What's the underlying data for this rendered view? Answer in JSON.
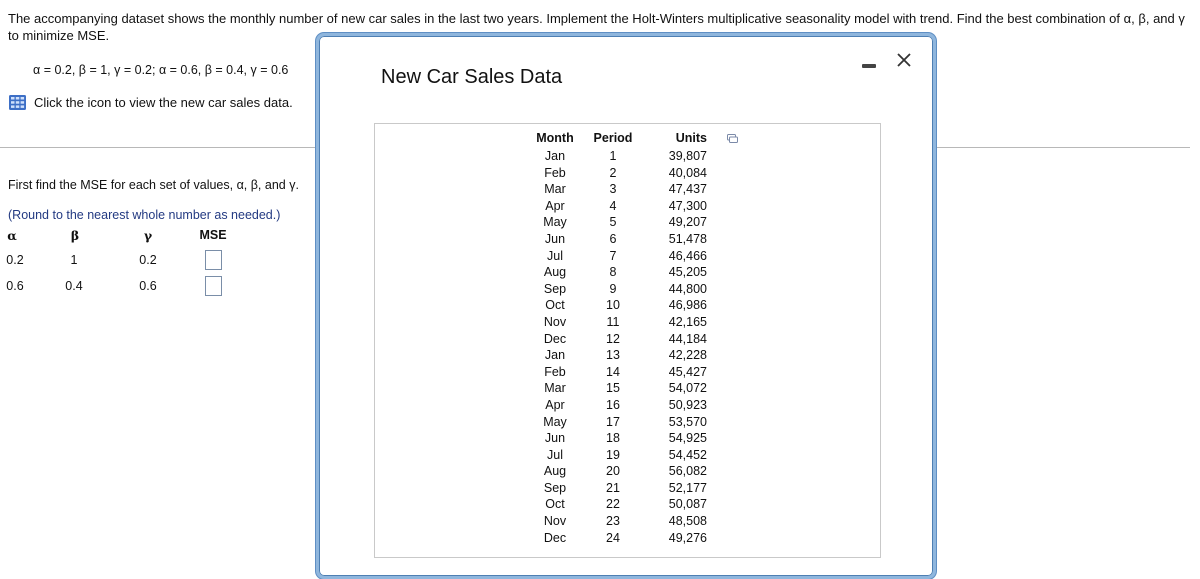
{
  "question": {
    "text": "The accompanying dataset shows the monthly number of new car sales in the last two years. Implement the Holt-Winters multiplicative seasonality model with trend. Find the best combination of α, β, and γ to minimize MSE.",
    "parameters": "α = 0.2, β = 1, γ = 0.2; α = 0.6, β = 0.4, γ = 0.6",
    "data_link": "Click the icon to view the new car sales data.",
    "data_link_icon": "table-grid-icon"
  },
  "answer_section": {
    "prompt": "First find the MSE for each set of values, α, β, and γ.",
    "note": "(Round to the nearest whole number as needed.)",
    "headers": [
      "α",
      "β",
      "γ",
      "MSE"
    ],
    "rows": [
      {
        "alpha": "0.2",
        "beta": "1",
        "gamma": "0.2",
        "mse": ""
      },
      {
        "alpha": "0.6",
        "beta": "0.4",
        "gamma": "0.6",
        "mse": ""
      }
    ]
  },
  "popup": {
    "title": "New Car Sales Data",
    "minimize_icon": "minimize-icon",
    "close_icon": "close-icon",
    "copy_icon": "copy-icon",
    "columns": [
      "Month",
      "Period",
      "Units"
    ],
    "rows": [
      {
        "month": "Jan",
        "period": "1",
        "units": "39,807"
      },
      {
        "month": "Feb",
        "period": "2",
        "units": "40,084"
      },
      {
        "month": "Mar",
        "period": "3",
        "units": "47,437"
      },
      {
        "month": "Apr",
        "period": "4",
        "units": "47,300"
      },
      {
        "month": "May",
        "period": "5",
        "units": "49,207"
      },
      {
        "month": "Jun",
        "period": "6",
        "units": "51,478"
      },
      {
        "month": "Jul",
        "period": "7",
        "units": "46,466"
      },
      {
        "month": "Aug",
        "period": "8",
        "units": "45,205"
      },
      {
        "month": "Sep",
        "period": "9",
        "units": "44,800"
      },
      {
        "month": "Oct",
        "period": "10",
        "units": "46,986"
      },
      {
        "month": "Nov",
        "period": "11",
        "units": "42,165"
      },
      {
        "month": "Dec",
        "period": "12",
        "units": "44,184"
      },
      {
        "month": "Jan",
        "period": "13",
        "units": "42,228"
      },
      {
        "month": "Feb",
        "period": "14",
        "units": "45,427"
      },
      {
        "month": "Mar",
        "period": "15",
        "units": "54,072"
      },
      {
        "month": "Apr",
        "period": "16",
        "units": "50,923"
      },
      {
        "month": "May",
        "period": "17",
        "units": "53,570"
      },
      {
        "month": "Jun",
        "period": "18",
        "units": "54,925"
      },
      {
        "month": "Jul",
        "period": "19",
        "units": "54,452"
      },
      {
        "month": "Aug",
        "period": "20",
        "units": "56,082"
      },
      {
        "month": "Sep",
        "period": "21",
        "units": "52,177"
      },
      {
        "month": "Oct",
        "period": "22",
        "units": "50,087"
      },
      {
        "month": "Nov",
        "period": "23",
        "units": "48,508"
      },
      {
        "month": "Dec",
        "period": "24",
        "units": "49,276"
      }
    ]
  }
}
